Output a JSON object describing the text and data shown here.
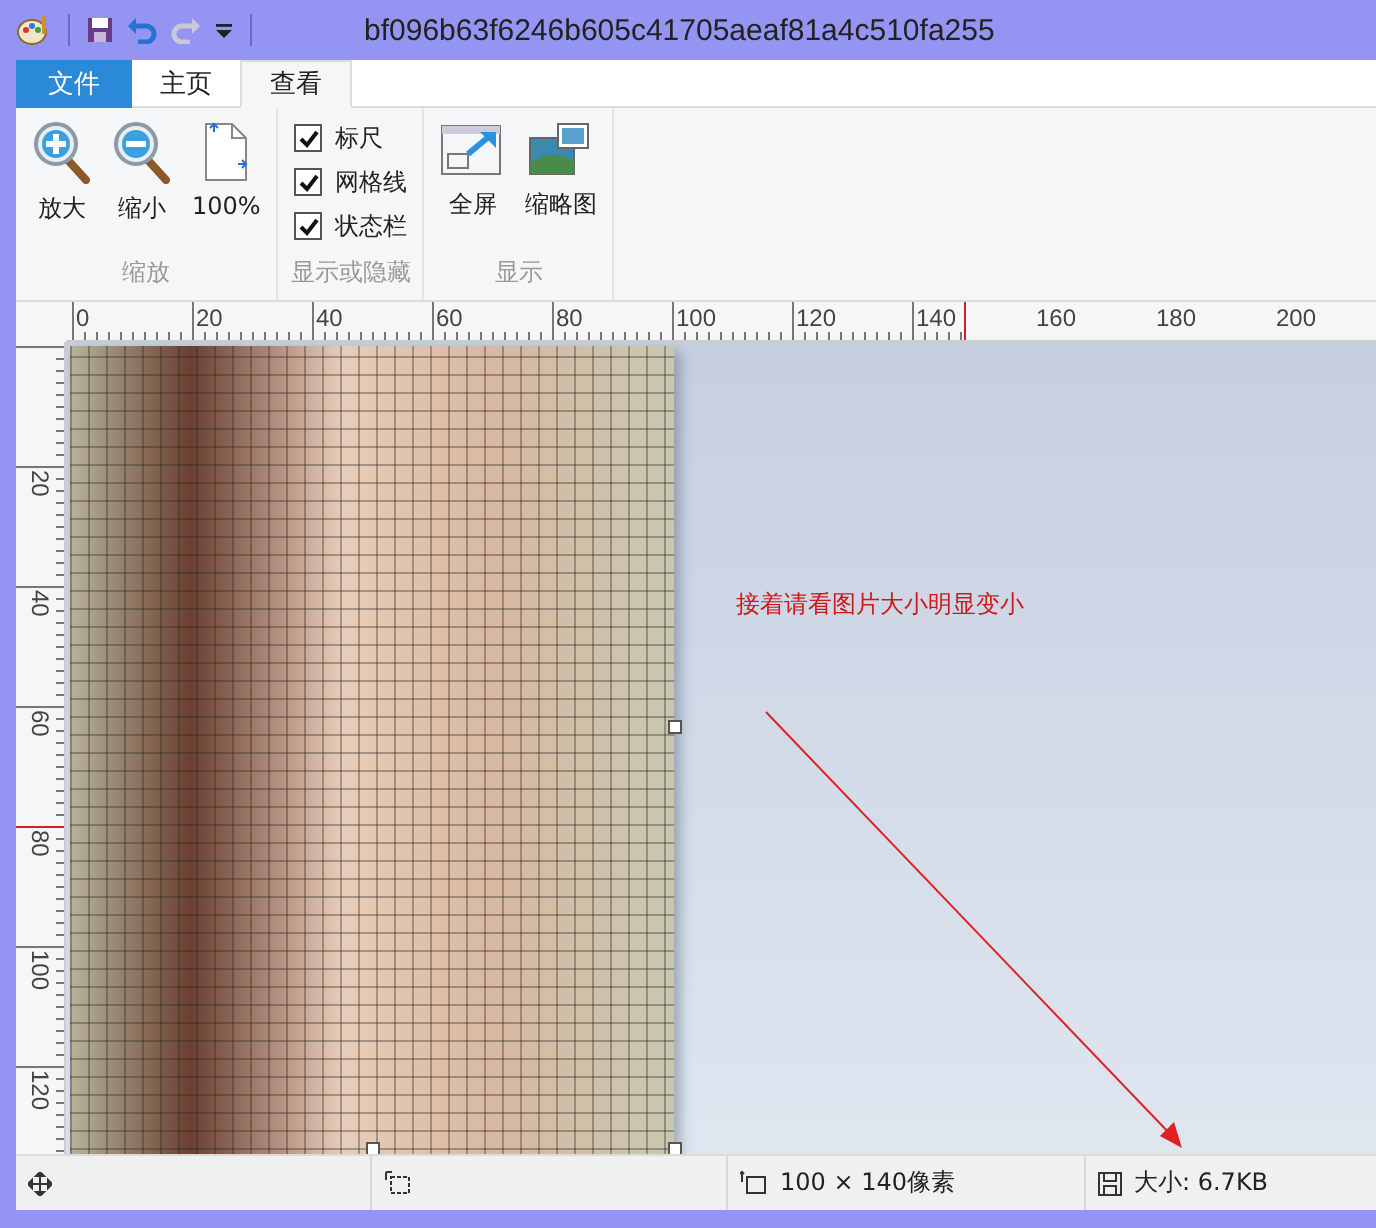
{
  "window": {
    "title": "bf096b63f6246b605c41705aeaf81a4c510fa255"
  },
  "tabs": [
    {
      "label": "文件",
      "kind": "file",
      "selected": false
    },
    {
      "label": "主页",
      "kind": "tab",
      "selected": false
    },
    {
      "label": "查看",
      "kind": "tab",
      "selected": true
    }
  ],
  "ribbon": {
    "groups": [
      {
        "label": "缩放",
        "kind": "buttons",
        "items": [
          {
            "label": "放大",
            "kind": "zoom_in"
          },
          {
            "label": "缩小",
            "kind": "zoom_out"
          },
          {
            "label": "100%",
            "kind": "actual_size"
          }
        ]
      },
      {
        "label": "显示或隐藏",
        "kind": "checks",
        "items": [
          {
            "label": "标尺",
            "kind": "rulers",
            "checked": true
          },
          {
            "label": "网格线",
            "kind": "gridlines",
            "checked": true
          },
          {
            "label": "状态栏",
            "kind": "statusbar",
            "checked": true
          }
        ]
      },
      {
        "label": "显示",
        "kind": "buttons",
        "items": [
          {
            "label": "全屏",
            "kind": "fullscreen"
          },
          {
            "label": "缩略图",
            "kind": "thumbnail"
          }
        ]
      }
    ]
  },
  "rulers": {
    "horizontal": [
      "0",
      "20",
      "40",
      "60",
      "80",
      "100",
      "120",
      "140",
      "160",
      "180",
      "200"
    ],
    "vertical": [
      "20",
      "40",
      "60",
      "80",
      "100",
      "120"
    ]
  },
  "canvas": {
    "annotation": "接着请看图片大小明显变小"
  },
  "status_bar": {
    "dimensions": "100 × 140像素",
    "size": "大小: 6.7KB"
  }
}
